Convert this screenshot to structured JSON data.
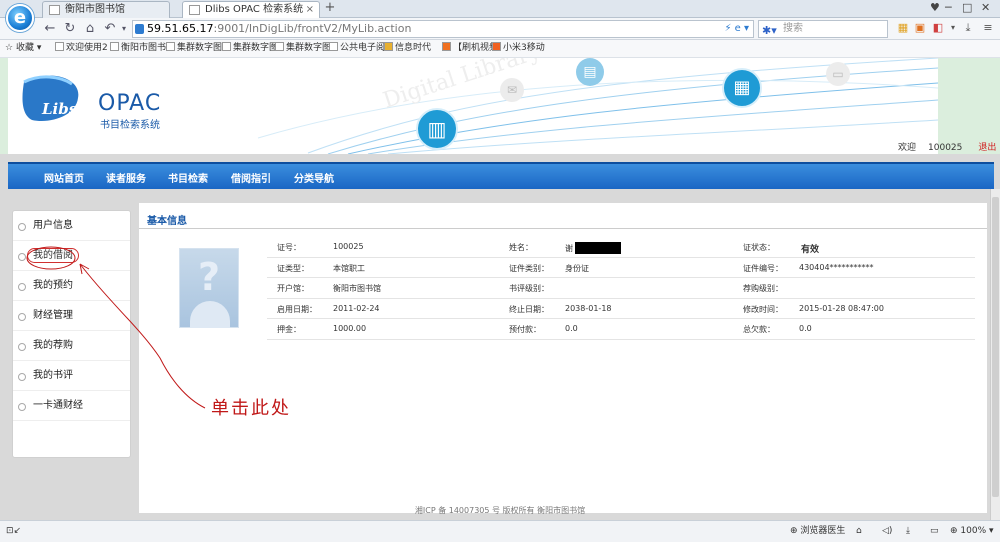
{
  "browser": {
    "tabs": [
      {
        "label": "衡阳市图书馆",
        "active": false
      },
      {
        "label": "Dlibs OPAC 检索系统",
        "active": true
      }
    ],
    "new_tab_label": "+",
    "url_host": "59.51.65.17",
    "url_path": ":9001/InDigLib/frontV2/MyLib.action",
    "search_placeholder": "搜索",
    "bookmarks": [
      "收藏",
      "欢迎使用2",
      "衡阳市图书",
      "集群数字图",
      "集群数字图",
      "集群数字图",
      "公共电子阅",
      "信息时代",
      "【刷机视频",
      "小米3移动"
    ],
    "status_items": [
      "浏览器医生",
      "100%"
    ]
  },
  "header": {
    "logo_libs": "Libs",
    "logo_title": "OPAC",
    "logo_subtitle": "书目检索系统",
    "welcome_label": "欢迎",
    "user_id": "100025",
    "logout_label": "退出"
  },
  "nav": {
    "items": [
      "网站首页",
      "读者服务",
      "书目检索",
      "借阅指引",
      "分类导航"
    ]
  },
  "sidebar": {
    "items": [
      "用户信息",
      "我的借阅",
      "我的预约",
      "财经管理",
      "我的荐购",
      "我的书评",
      "一卡通财经"
    ]
  },
  "content": {
    "title": "基本信息",
    "rows": [
      [
        {
          "label": "证号：",
          "value": "100025"
        },
        {
          "label": "姓名：",
          "value": "谢"
        },
        {
          "label": "证状态：",
          "value": "有效"
        }
      ],
      [
        {
          "label": "证类型：",
          "value": "本馆职工"
        },
        {
          "label": "证件类别：",
          "value": "身份证"
        },
        {
          "label": "证件编号：",
          "value": "430404***********"
        }
      ],
      [
        {
          "label": "开户馆：",
          "value": "衡阳市图书馆"
        },
        {
          "label": "书评级别：",
          "value": ""
        },
        {
          "label": "荐购级别：",
          "value": ""
        }
      ],
      [
        {
          "label": "启用日期：",
          "value": "2011-02-24"
        },
        {
          "label": "终止日期：",
          "value": "2038-01-18"
        },
        {
          "label": "修改时间：",
          "value": "2015-01-28 08:47:00"
        }
      ],
      [
        {
          "label": "押金：",
          "value": "1000.00"
        },
        {
          "label": "预付款：",
          "value": "0.0"
        },
        {
          "label": "总欠款：",
          "value": "0.0"
        }
      ]
    ]
  },
  "footer": {
    "text": "湘ICP 备 14007305 号 版权所有 衡阳市图书馆"
  },
  "annotation": {
    "text": "单击此处"
  },
  "colors": {
    "nav_blue": "#1a66c4",
    "logo_blue": "#1a5aa8",
    "annotation_red": "#c01818"
  }
}
